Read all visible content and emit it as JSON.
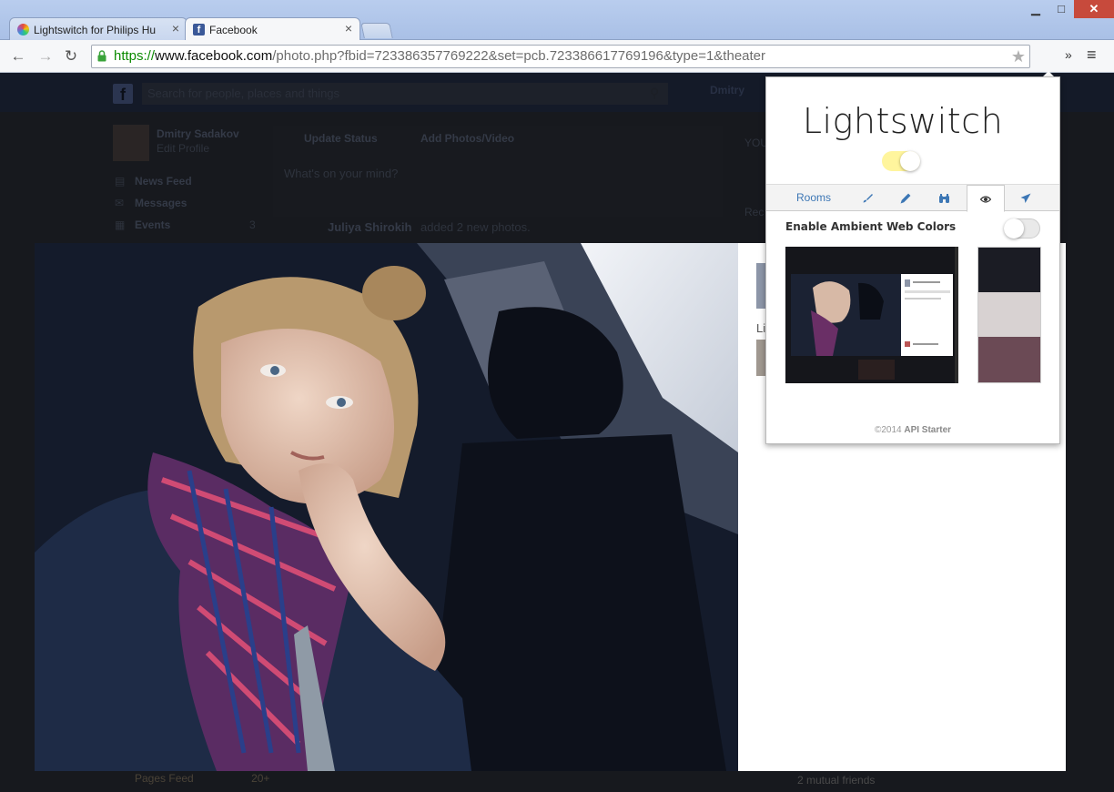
{
  "browser": {
    "tabs": [
      {
        "title": "Lightswitch for Philips Hu",
        "close": "×"
      },
      {
        "title": "Facebook",
        "close": "×"
      }
    ],
    "url": {
      "scheme": "https://",
      "host": "www.facebook.com",
      "path": "/photo.php?fbid=723386357769222&set=pcb.723386617769196&type=1&theater"
    },
    "window_controls": {
      "minimize": "▁",
      "maximize": "□",
      "close": "✕"
    },
    "nav": {
      "back": "←",
      "forward": "→",
      "reload": "↻"
    },
    "star": "★",
    "overflow": "»",
    "menu": "≡"
  },
  "facebook": {
    "logo": "f",
    "search_placeholder": "Search for people, places and things",
    "top_user": "Dmitry",
    "profile_name": "Dmitry Sadakov",
    "edit_profile": "Edit Profile",
    "update_status": "Update Status",
    "add_photos": "Add Photos/Video",
    "composer_placeholder": "What's on your mind?",
    "nav_items": [
      {
        "label": "News Feed"
      },
      {
        "label": "Messages"
      },
      {
        "label": "Events",
        "count": "3"
      }
    ],
    "post_author": "Juliya Shirokih",
    "post_action": " added 2 new photos.",
    "right_heading": "YOU",
    "right_rec": "Rec",
    "theater_like": "Li",
    "bottom_left": "Pages Feed",
    "bottom_left_count": "20+",
    "bottom_right": "2 mutual friends"
  },
  "lightswitch": {
    "title": "Lightswitch",
    "power_on": true,
    "tabs": [
      {
        "label": "Rooms",
        "icon": "rooms"
      },
      {
        "label": "",
        "icon": "brush-icon"
      },
      {
        "label": "",
        "icon": "eyedropper-icon"
      },
      {
        "label": "",
        "icon": "binoculars-icon"
      },
      {
        "label": "",
        "icon": "eye-icon"
      },
      {
        "label": "",
        "icon": "send-icon"
      }
    ],
    "active_tab": 4,
    "ambient_label": "Enable Ambient Web Colors",
    "ambient_enabled": false,
    "swatches": [
      "#1b1c24",
      "#d8d2d2",
      "#6b4a55"
    ],
    "footer_year": "©2014",
    "footer_brand": "API Starter",
    "colors": {
      "toggle_on": "#fff59d",
      "tab_link": "#3d77b5"
    }
  }
}
